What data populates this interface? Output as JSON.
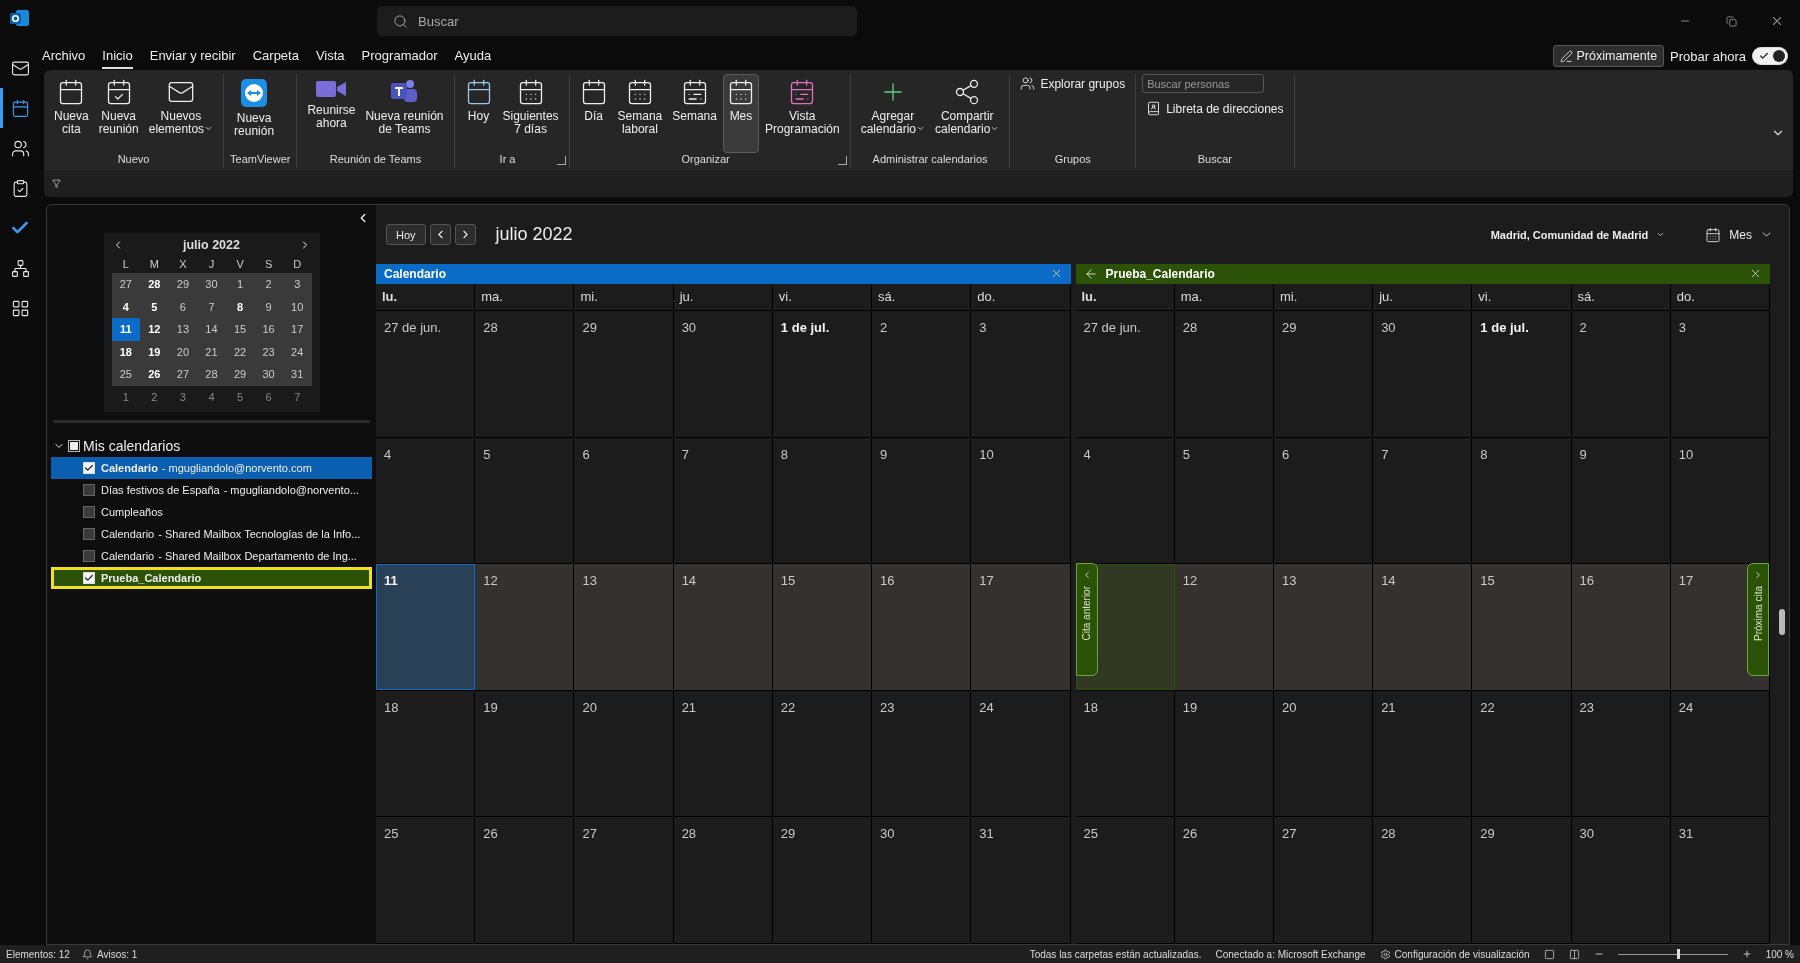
{
  "title_bar": {
    "search_placeholder": "Buscar"
  },
  "menu_tabs": [
    {
      "label": "Archivo",
      "selected": false
    },
    {
      "label": "Inicio",
      "selected": true
    },
    {
      "label": "Enviar y recibir",
      "selected": false
    },
    {
      "label": "Carpeta",
      "selected": false
    },
    {
      "label": "Vista",
      "selected": false
    },
    {
      "label": "Programador",
      "selected": false
    },
    {
      "label": "Ayuda",
      "selected": false
    }
  ],
  "coming_soon_button": "Próximamente",
  "try_now": {
    "label": "Probar ahora",
    "on": true
  },
  "ribbon": [
    {
      "label": "Nuevo",
      "launcher": false,
      "items": [
        {
          "kind": "large",
          "label": "Nueva\ncita",
          "dropdown": false
        },
        {
          "kind": "large",
          "label": "Nueva\nreunión",
          "dropdown": false
        },
        {
          "kind": "large",
          "label": "Nuevos\nelementos",
          "dropdown": true
        }
      ]
    },
    {
      "label": "TeamViewer",
      "launcher": false,
      "items": [
        {
          "kind": "large",
          "label": "Nueva\nreunión",
          "dropdown": false
        }
      ]
    },
    {
      "label": "Reunión de Teams",
      "launcher": false,
      "items": [
        {
          "kind": "large",
          "label": "Reunirse\nahora",
          "dropdown": false
        },
        {
          "kind": "large",
          "label": "Nueva reunión\nde Teams",
          "dropdown": false
        }
      ]
    },
    {
      "label": "Ir a",
      "launcher": true,
      "items": [
        {
          "kind": "large",
          "label": "Hoy",
          "dropdown": false
        },
        {
          "kind": "large",
          "label": "Siguientes\n7 días",
          "dropdown": false
        }
      ]
    },
    {
      "label": "Organizar",
      "launcher": true,
      "items": [
        {
          "kind": "large",
          "label": "Día",
          "dropdown": false,
          "selected": false
        },
        {
          "kind": "large",
          "label": "Semana\nlaboral",
          "dropdown": false,
          "selected": false
        },
        {
          "kind": "large",
          "label": "Semana",
          "dropdown": false,
          "selected": false
        },
        {
          "kind": "large",
          "label": "Mes",
          "dropdown": false,
          "selected": true
        },
        {
          "kind": "large",
          "label": "Vista\nProgramación",
          "dropdown": false,
          "selected": false
        }
      ]
    },
    {
      "label": "Administrar calendarios",
      "launcher": false,
      "items": [
        {
          "kind": "large",
          "label": "Agregar\ncalendario",
          "dropdown": true
        },
        {
          "kind": "large",
          "label": "Compartir\ncalendario",
          "dropdown": true
        }
      ]
    },
    {
      "label": "Grupos",
      "launcher": false,
      "items": [
        {
          "kind": "small",
          "label": "Explorar grupos",
          "dropdown": false
        }
      ]
    },
    {
      "label": "Buscar",
      "launcher": false,
      "items": [
        {
          "kind": "field",
          "placeholder": "Buscar personas"
        },
        {
          "kind": "small",
          "label": "Libreta de direcciones",
          "dropdown": false
        }
      ]
    }
  ],
  "mini_calendar": {
    "title": "julio 2022",
    "weekdays": [
      "L",
      "M",
      "X",
      "J",
      "V",
      "S",
      "D"
    ],
    "weeks": [
      [
        {
          "label": "27",
          "bold": false,
          "selected": false
        },
        {
          "label": "28",
          "bold": true,
          "selected": false
        },
        {
          "label": "29",
          "bold": false,
          "selected": false
        },
        {
          "label": "30",
          "bold": false,
          "selected": false
        },
        {
          "label": "1",
          "bold": false,
          "selected": false
        },
        {
          "label": "2",
          "bold": false,
          "selected": false
        },
        {
          "label": "3",
          "bold": false,
          "selected": false
        }
      ],
      [
        {
          "label": "4",
          "bold": true,
          "selected": false
        },
        {
          "label": "5",
          "bold": true,
          "selected": false
        },
        {
          "label": "6",
          "bold": false,
          "selected": false
        },
        {
          "label": "7",
          "bold": false,
          "selected": false
        },
        {
          "label": "8",
          "bold": true,
          "selected": false
        },
        {
          "label": "9",
          "bold": false,
          "selected": false
        },
        {
          "label": "10",
          "bold": false,
          "selected": false
        }
      ],
      [
        {
          "label": "11",
          "bold": true,
          "selected": true
        },
        {
          "label": "12",
          "bold": true,
          "selected": false
        },
        {
          "label": "13",
          "bold": false,
          "selected": false
        },
        {
          "label": "14",
          "bold": false,
          "selected": false
        },
        {
          "label": "15",
          "bold": false,
          "selected": false
        },
        {
          "label": "16",
          "bold": false,
          "selected": false
        },
        {
          "label": "17",
          "bold": false,
          "selected": false
        }
      ],
      [
        {
          "label": "18",
          "bold": true,
          "selected": false
        },
        {
          "label": "19",
          "bold": true,
          "selected": false
        },
        {
          "label": "20",
          "bold": false,
          "selected": false
        },
        {
          "label": "21",
          "bold": false,
          "selected": false
        },
        {
          "label": "22",
          "bold": false,
          "selected": false
        },
        {
          "label": "23",
          "bold": false,
          "selected": false
        },
        {
          "label": "24",
          "bold": false,
          "selected": false
        }
      ],
      [
        {
          "label": "25",
          "bold": false,
          "selected": false
        },
        {
          "label": "26",
          "bold": true,
          "selected": false
        },
        {
          "label": "27",
          "bold": false,
          "selected": false
        },
        {
          "label": "28",
          "bold": false,
          "selected": false
        },
        {
          "label": "29",
          "bold": false,
          "selected": false
        },
        {
          "label": "30",
          "bold": false,
          "selected": false
        },
        {
          "label": "31",
          "bold": false,
          "selected": false
        }
      ]
    ],
    "trailing_week": [
      "1",
      "2",
      "3",
      "4",
      "5",
      "6",
      "7"
    ]
  },
  "calendar_list": {
    "label": "Mis calendarios",
    "expanded": true,
    "indeterminate": true,
    "items": [
      {
        "name": "Calendario",
        "detail": "- mgugliandolo@norvento.com",
        "checked": true,
        "focused": false,
        "color": "#0a5fb0"
      },
      {
        "name": "Días festivos de España",
        "detail": "- mgugliandolo@norvento...",
        "checked": false,
        "focused": false
      },
      {
        "name": "Cumpleaños",
        "checked": false,
        "focused": false
      },
      {
        "name": "Calendario",
        "detail": "- Shared Mailbox Tecnologías de la Info...",
        "checked": false,
        "focused": false
      },
      {
        "name": "Calendario",
        "detail": "- Shared Mailbox Departamento de Ing...",
        "checked": false,
        "focused": false
      },
      {
        "name": "Prueba_Calendario",
        "checked": true,
        "focused": true,
        "color": "#2c5208"
      }
    ]
  },
  "view_header": {
    "today_button": "Hoy",
    "title": "julio 2022",
    "location": "Madrid, Comunidad de Madrid",
    "view": "Mes"
  },
  "calendars": [
    {
      "name": "Calendario",
      "color": "#0a6cc7",
      "back_arrow": false,
      "weekdays": [
        {
          "label": "lu.",
          "today": true
        },
        {
          "label": "ma.",
          "today": false
        },
        {
          "label": "mi.",
          "today": false
        },
        {
          "label": "ju.",
          "today": false
        },
        {
          "label": "vi.",
          "today": false
        },
        {
          "label": "sá.",
          "today": false
        },
        {
          "label": "do.",
          "today": false
        }
      ],
      "weeks": [
        {
          "current": false,
          "days": [
            {
              "label": "27 de jun.",
              "bold": false,
              "today": false
            },
            {
              "label": "28",
              "bold": false,
              "today": false
            },
            {
              "label": "29",
              "bold": false,
              "today": false
            },
            {
              "label": "30",
              "bold": false,
              "today": false
            },
            {
              "label": "1 de jul.",
              "bold": true,
              "today": false
            },
            {
              "label": "2",
              "bold": false,
              "today": false
            },
            {
              "label": "3",
              "bold": false,
              "today": false
            }
          ]
        },
        {
          "current": false,
          "days": [
            {
              "label": "4",
              "bold": false,
              "today": false
            },
            {
              "label": "5",
              "bold": false,
              "today": false
            },
            {
              "label": "6",
              "bold": false,
              "today": false
            },
            {
              "label": "7",
              "bold": false,
              "today": false
            },
            {
              "label": "8",
              "bold": false,
              "today": false
            },
            {
              "label": "9",
              "bold": false,
              "today": false
            },
            {
              "label": "10",
              "bold": false,
              "today": false
            }
          ]
        },
        {
          "current": true,
          "days": [
            {
              "label": "11",
              "bold": true,
              "today": true
            },
            {
              "label": "12",
              "bold": false,
              "today": false
            },
            {
              "label": "13",
              "bold": false,
              "today": false
            },
            {
              "label": "14",
              "bold": false,
              "today": false
            },
            {
              "label": "15",
              "bold": false,
              "today": false
            },
            {
              "label": "16",
              "bold": false,
              "today": false
            },
            {
              "label": "17",
              "bold": false,
              "today": false
            }
          ]
        },
        {
          "current": false,
          "days": [
            {
              "label": "18",
              "bold": false,
              "today": false
            },
            {
              "label": "19",
              "bold": false,
              "today": false
            },
            {
              "label": "20",
              "bold": false,
              "today": false
            },
            {
              "label": "21",
              "bold": false,
              "today": false
            },
            {
              "label": "22",
              "bold": false,
              "today": false
            },
            {
              "label": "23",
              "bold": false,
              "today": false
            },
            {
              "label": "24",
              "bold": false,
              "today": false
            }
          ]
        },
        {
          "current": false,
          "days": [
            {
              "label": "25",
              "bold": false,
              "today": false
            },
            {
              "label": "26",
              "bold": false,
              "today": false
            },
            {
              "label": "27",
              "bold": false,
              "today": false
            },
            {
              "label": "28",
              "bold": false,
              "today": false
            },
            {
              "label": "29",
              "bold": false,
              "today": false
            },
            {
              "label": "30",
              "bold": false,
              "today": false
            },
            {
              "label": "31",
              "bold": false,
              "today": false
            }
          ]
        }
      ]
    },
    {
      "name": "Prueba_Calendario",
      "color": "#2c5208",
      "back_arrow": true,
      "appointment_nav": {
        "previous": "Cita anterior",
        "next": "Próxima cita"
      },
      "weekdays": [
        {
          "label": "lu.",
          "today": true
        },
        {
          "label": "ma.",
          "today": false
        },
        {
          "label": "mi.",
          "today": false
        },
        {
          "label": "ju.",
          "today": false
        },
        {
          "label": "vi.",
          "today": false
        },
        {
          "label": "sá.",
          "today": false
        },
        {
          "label": "do.",
          "today": false
        }
      ],
      "weeks": [
        {
          "current": false,
          "days": [
            {
              "label": "27 de jun.",
              "bold": false,
              "today": false
            },
            {
              "label": "28",
              "bold": false,
              "today": false
            },
            {
              "label": "29",
              "bold": false,
              "today": false
            },
            {
              "label": "30",
              "bold": false,
              "today": false
            },
            {
              "label": "1 de jul.",
              "bold": true,
              "today": false
            },
            {
              "label": "2",
              "bold": false,
              "today": false
            },
            {
              "label": "3",
              "bold": false,
              "today": false
            }
          ]
        },
        {
          "current": false,
          "days": [
            {
              "label": "4",
              "bold": false,
              "today": false
            },
            {
              "label": "5",
              "bold": false,
              "today": false
            },
            {
              "label": "6",
              "bold": false,
              "today": false
            },
            {
              "label": "7",
              "bold": false,
              "today": false
            },
            {
              "label": "8",
              "bold": false,
              "today": false
            },
            {
              "label": "9",
              "bold": false,
              "today": false
            },
            {
              "label": "10",
              "bold": false,
              "today": false
            }
          ]
        },
        {
          "current": true,
          "days": [
            {
              "today": true
            },
            {
              "label": "12",
              "bold": false,
              "today": false
            },
            {
              "label": "13",
              "bold": false,
              "today": false
            },
            {
              "label": "14",
              "bold": false,
              "today": false
            },
            {
              "label": "15",
              "bold": false,
              "today": false
            },
            {
              "label": "16",
              "bold": false,
              "today": false
            },
            {
              "label": "17",
              "bold": false,
              "today": false
            }
          ]
        },
        {
          "current": false,
          "days": [
            {
              "label": "18",
              "bold": false,
              "today": false
            },
            {
              "label": "19",
              "bold": false,
              "today": false
            },
            {
              "label": "20",
              "bold": false,
              "today": false
            },
            {
              "label": "21",
              "bold": false,
              "today": false
            },
            {
              "label": "22",
              "bold": false,
              "today": false
            },
            {
              "label": "23",
              "bold": false,
              "today": false
            },
            {
              "label": "24",
              "bold": false,
              "today": false
            }
          ]
        },
        {
          "current": false,
          "days": [
            {
              "label": "25",
              "bold": false,
              "today": false
            },
            {
              "label": "26",
              "bold": false,
              "today": false
            },
            {
              "label": "27",
              "bold": false,
              "today": false
            },
            {
              "label": "28",
              "bold": false,
              "today": false
            },
            {
              "label": "29",
              "bold": false,
              "today": false
            },
            {
              "label": "30",
              "bold": false,
              "today": false
            },
            {
              "label": "31",
              "bold": false,
              "today": false
            }
          ]
        }
      ]
    }
  ],
  "status_bar": {
    "items": "Elementos: 12",
    "reminders": "Avisos: 1",
    "sync": "Todas las carpetas están actualizadas.",
    "connection": "Conectado a: Microsoft Exchange",
    "display_settings": "Configuración de visualización",
    "zoom": {
      "level": 0.55
    },
    "zoom_label": "100 %"
  }
}
